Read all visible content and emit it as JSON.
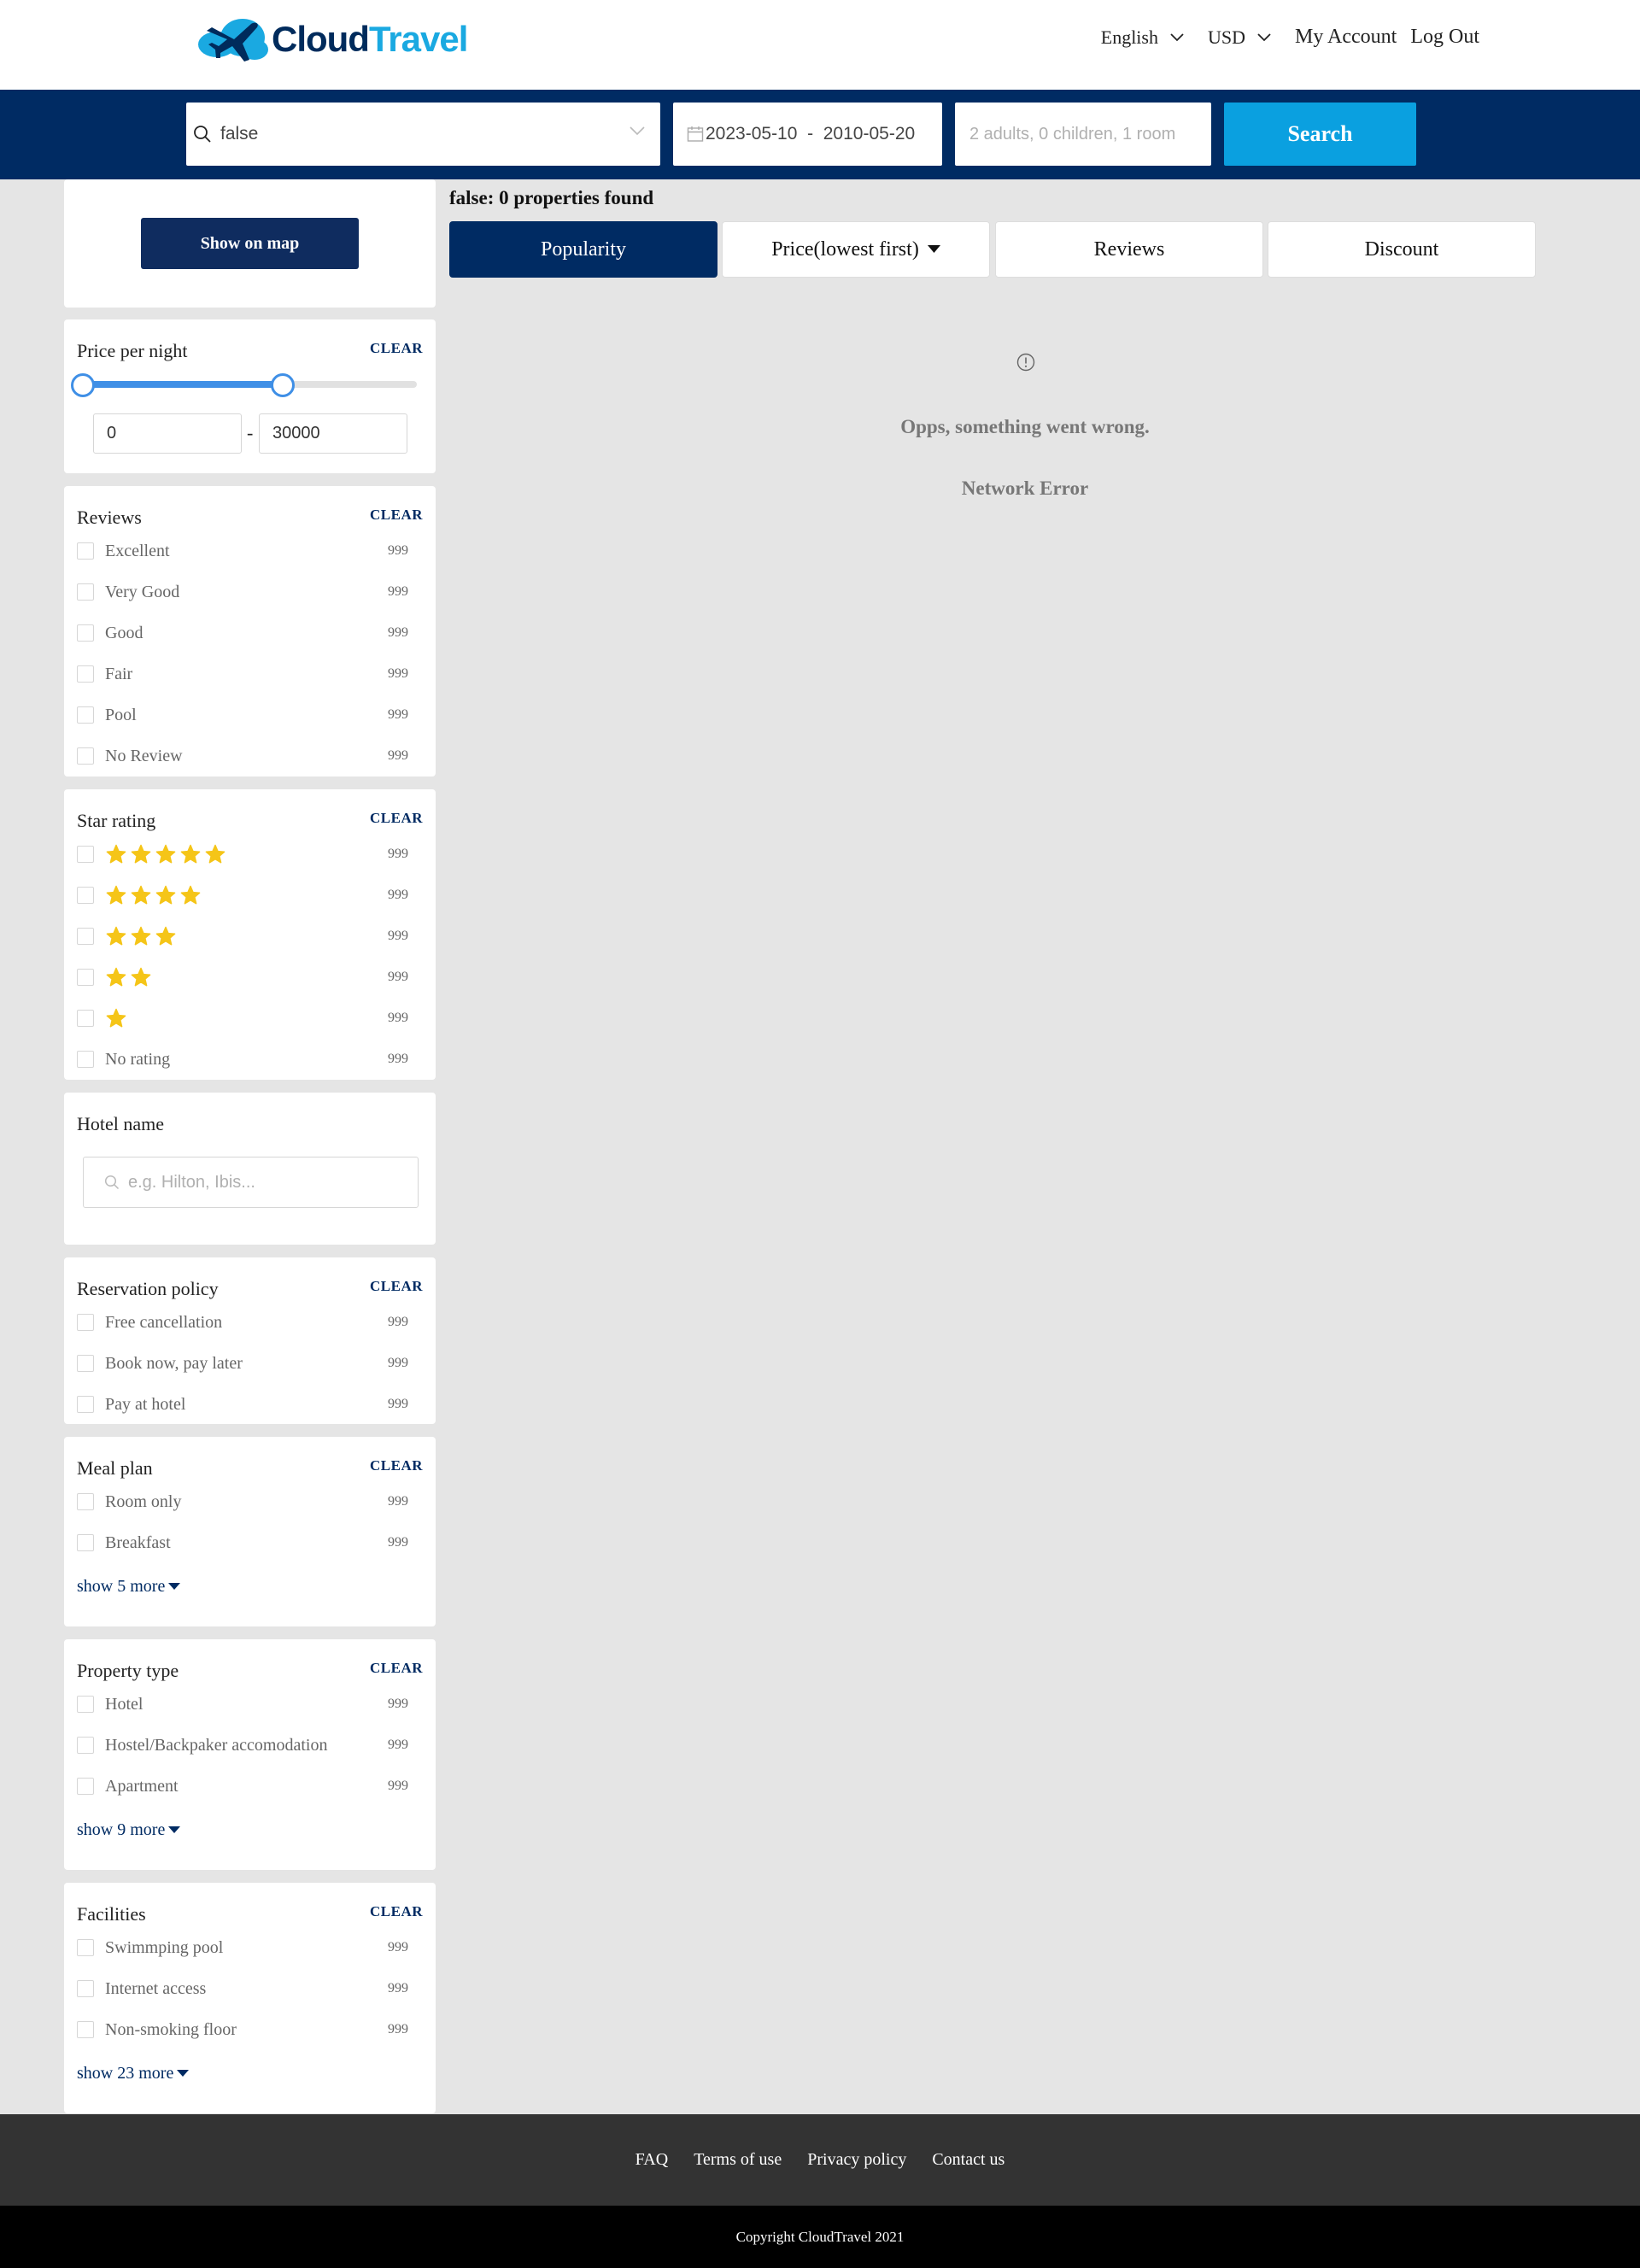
{
  "header": {
    "logo_part1": "Cloud",
    "logo_part2": "Travel",
    "language": "English",
    "currency": "USD",
    "my_account": "My Account",
    "logout": "Log Out"
  },
  "search": {
    "destination_value": "false",
    "dates_value": "2023-05-10  -  2010-05-20",
    "guests_placeholder": "2 adults, 0 children, 1 room",
    "button_label": "Search"
  },
  "sidebar": {
    "show_on_map": "Show on map",
    "clear_label": "CLEAR",
    "price": {
      "title": "Price per night",
      "min": "0",
      "max": "30000",
      "low_fraction": 0,
      "high_fraction": 0.6
    },
    "reviews": {
      "title": "Reviews",
      "items": [
        {
          "label": "Excellent",
          "count": "999"
        },
        {
          "label": "Very Good",
          "count": "999"
        },
        {
          "label": "Good",
          "count": "999"
        },
        {
          "label": "Fair",
          "count": "999"
        },
        {
          "label": "Pool",
          "count": "999"
        },
        {
          "label": "No Review",
          "count": "999"
        }
      ]
    },
    "star_rating": {
      "title": "Star rating",
      "items": [
        {
          "stars": 5,
          "count": "999"
        },
        {
          "stars": 4,
          "count": "999"
        },
        {
          "stars": 3,
          "count": "999"
        },
        {
          "stars": 2,
          "count": "999"
        },
        {
          "stars": 1,
          "count": "999"
        },
        {
          "label": "No rating",
          "count": "999"
        }
      ],
      "star_color": "#f5c518"
    },
    "hotel_name": {
      "title": "Hotel name",
      "placeholder": "e.g. Hilton, Ibis..."
    },
    "reservation_policy": {
      "title": "Reservation policy",
      "items": [
        {
          "label": "Free cancellation",
          "count": "999"
        },
        {
          "label": "Book now, pay later",
          "count": "999"
        },
        {
          "label": "Pay at hotel",
          "count": "999"
        }
      ]
    },
    "meal_plan": {
      "title": "Meal plan",
      "items": [
        {
          "label": "Room only",
          "count": "999"
        },
        {
          "label": "Breakfast",
          "count": "999"
        }
      ],
      "show_more": "show 5 more"
    },
    "property_type": {
      "title": "Property type",
      "items": [
        {
          "label": "Hotel",
          "count": "999"
        },
        {
          "label": "Hostel/Backpaker accomodation",
          "count": "999"
        },
        {
          "label": "Apartment",
          "count": "999"
        }
      ],
      "show_more": "show 9 more"
    },
    "facilities": {
      "title": "Facilities",
      "items": [
        {
          "label": "Swimmping pool",
          "count": "999"
        },
        {
          "label": "Internet access",
          "count": "999"
        },
        {
          "label": "Non-smoking floor",
          "count": "999"
        }
      ],
      "show_more": "show 23 more"
    }
  },
  "results": {
    "summary": "false: 0 properties found",
    "sort_tabs": [
      "Popularity",
      "Price(lowest first)",
      "Reviews",
      "Discount"
    ],
    "active_tab": "Popularity",
    "error_title": "Opps, something went wrong.",
    "error_detail": "Network Error"
  },
  "footer": {
    "links": [
      "FAQ",
      "Terms of use",
      "Privacy policy",
      "Contact us"
    ],
    "copyright": "Copyright CloudTravel 2021"
  },
  "colors": {
    "brand_navy": "#002b63",
    "brand_blue": "#0aa0e0",
    "slider_blue": "#3f8fe6"
  }
}
